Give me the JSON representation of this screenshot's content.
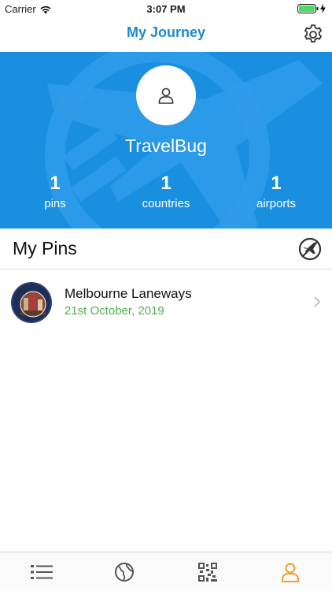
{
  "status_bar": {
    "carrier": "Carrier",
    "time": "3:07 PM"
  },
  "nav": {
    "title": "My Journey",
    "settings_icon": "gear-icon"
  },
  "profile": {
    "username": "TravelBug",
    "stats": [
      {
        "value": "1",
        "label": "pins"
      },
      {
        "value": "1",
        "label": "countries"
      },
      {
        "value": "1",
        "label": "airports"
      }
    ]
  },
  "pins_section": {
    "title": "My Pins",
    "action_icon": "no-flight-icon"
  },
  "pins": [
    {
      "title": "Melbourne Laneways",
      "date": "21st October, 2019",
      "badge_text": "MELBOURNE AUSTRALIA MEL"
    }
  ],
  "tabs": [
    {
      "name": "list-icon",
      "active": false
    },
    {
      "name": "globe-icon",
      "active": false
    },
    {
      "name": "qr-code-icon",
      "active": false
    },
    {
      "name": "profile-icon",
      "active": true
    }
  ],
  "colors": {
    "brand_blue": "#1a8fe0",
    "title_blue": "#1e88d0",
    "date_green": "#4caf50",
    "active_tab": "#f0a030",
    "inactive_tab": "#555555"
  }
}
